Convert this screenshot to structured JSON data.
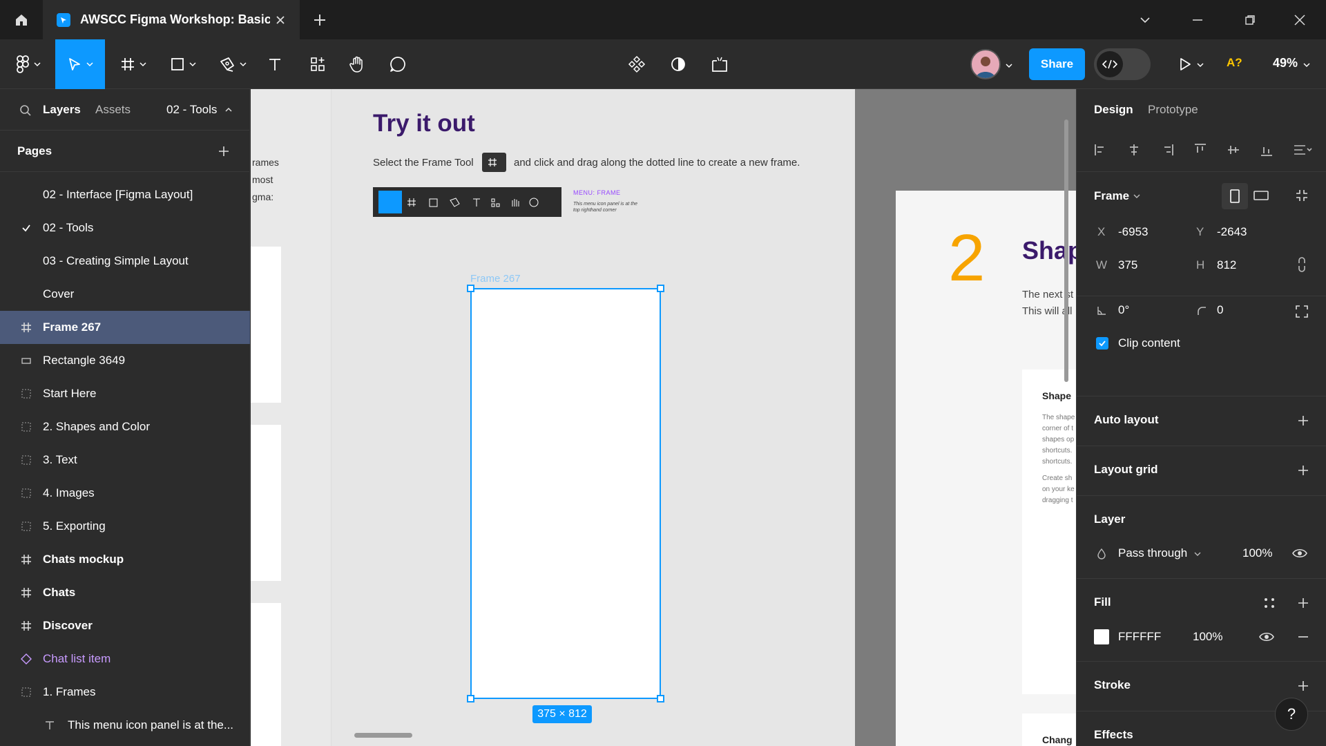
{
  "titlebar": {
    "tab_title": "AWSCC Figma Workshop: Basics (C",
    "colors": {
      "accent": "#0d99ff"
    }
  },
  "toolbar": {
    "share_label": "Share",
    "zoom": "49%",
    "a_label": "A?"
  },
  "left_panel": {
    "tabs": {
      "layers": "Layers",
      "assets": "Assets",
      "page_selector": "02 - Tools"
    },
    "pages_header": "Pages",
    "pages": [
      {
        "label": "02 - Interface [Figma Layout]",
        "checked": false
      },
      {
        "label": "02 - Tools",
        "checked": true
      },
      {
        "label": "03 - Creating Simple Layout",
        "checked": false
      },
      {
        "label": "Cover",
        "checked": false
      }
    ],
    "layers": [
      {
        "label": "Frame 267",
        "icon": "frame-icon",
        "selected": true,
        "bold": true
      },
      {
        "label": "Rectangle 3649",
        "icon": "rectangle-icon"
      },
      {
        "label": "Start Here",
        "icon": "section-icon"
      },
      {
        "label": "2. Shapes and Color",
        "icon": "section-icon"
      },
      {
        "label": "3. Text",
        "icon": "section-icon"
      },
      {
        "label": "4. Images",
        "icon": "section-icon"
      },
      {
        "label": "5. Exporting",
        "icon": "section-icon"
      },
      {
        "label": "Chats mockup",
        "icon": "frame-icon",
        "bold": true
      },
      {
        "label": "Chats",
        "icon": "frame-icon",
        "bold": true
      },
      {
        "label": "Discover",
        "icon": "frame-icon",
        "bold": true
      },
      {
        "label": "Chat list item",
        "icon": "component-icon",
        "component": true
      },
      {
        "label": "1. Frames",
        "icon": "section-icon"
      },
      {
        "label": "This menu icon panel is at the...",
        "icon": "text-icon"
      }
    ]
  },
  "canvas": {
    "left_fragments": [
      "rames",
      "most",
      "gma:"
    ],
    "title": "Try it out",
    "instruction_pre": "Select the Frame Tool",
    "instruction_post": "and click and drag along the dotted line to create a new frame.",
    "menu_label": "MENU: FRAME",
    "menu_note": "This menu icon panel is at the top righthand corner",
    "frame_name": "Frame 267",
    "frame_size": "375 × 812",
    "right_number": "2",
    "right_title": "Shap",
    "right_body_1": "The next st",
    "right_body_2": "This will all",
    "card_title": "Shape",
    "card_lines": [
      "The shape",
      "corner of t",
      "shapes op",
      "shortcuts.",
      "shortcuts."
    ],
    "card_lines_2": [
      "Create sh",
      "on your ke",
      "dragging t"
    ],
    "card2_title": "Chang"
  },
  "right_panel": {
    "tabs": {
      "design": "Design",
      "prototype": "Prototype"
    },
    "frame": {
      "title": "Frame",
      "x_label": "X",
      "x": "-6953",
      "y_label": "Y",
      "y": "-2643",
      "w_label": "W",
      "w": "375",
      "h_label": "H",
      "h": "812",
      "rotation": "0°",
      "radius": "0",
      "clip_label": "Clip content"
    },
    "auto_layout": "Auto layout",
    "layout_grid": "Layout grid",
    "layer": {
      "title": "Layer",
      "blend": "Pass through",
      "opacity": "100%"
    },
    "fill": {
      "title": "Fill",
      "hex": "FFFFFF",
      "opacity": "100%",
      "swatch": "#ffffff"
    },
    "stroke": "Stroke",
    "effects": "Effects",
    "help": "?"
  }
}
